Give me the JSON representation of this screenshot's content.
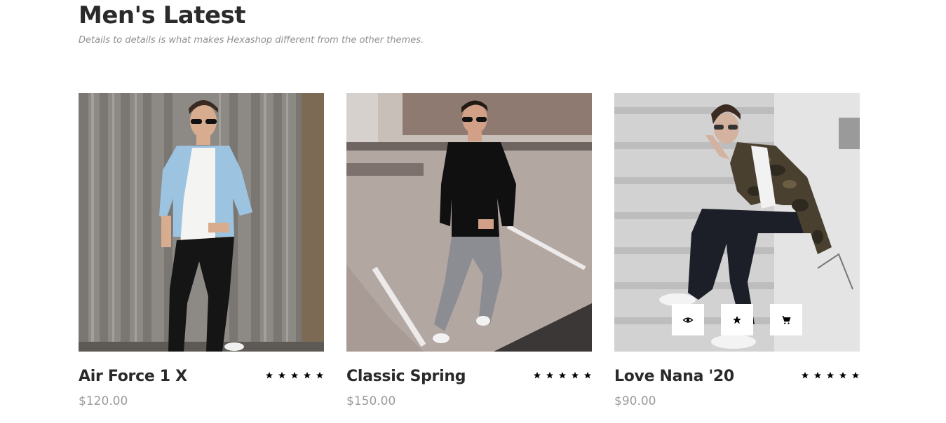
{
  "section": {
    "title": "Men's Latest",
    "subtitle": "Details to details is what makes Hexashop different from the other themes."
  },
  "products": [
    {
      "name": "Air Force 1 X",
      "price": "$120.00",
      "rating": 5,
      "image_icon": "man-denim-jacket-photo"
    },
    {
      "name": "Classic Spring",
      "price": "$150.00",
      "rating": 5,
      "image_icon": "man-black-sweater-photo"
    },
    {
      "name": "Love Nana '20",
      "price": "$90.00",
      "rating": 5,
      "image_icon": "man-camo-jacket-photo",
      "hover_actions": [
        "view-icon",
        "star-icon",
        "cart-icon"
      ]
    }
  ],
  "colors": {
    "heading": "#2a2a2a",
    "subtitle": "#8f8f8f",
    "price": "#9b9b9b",
    "star": "#000000"
  }
}
